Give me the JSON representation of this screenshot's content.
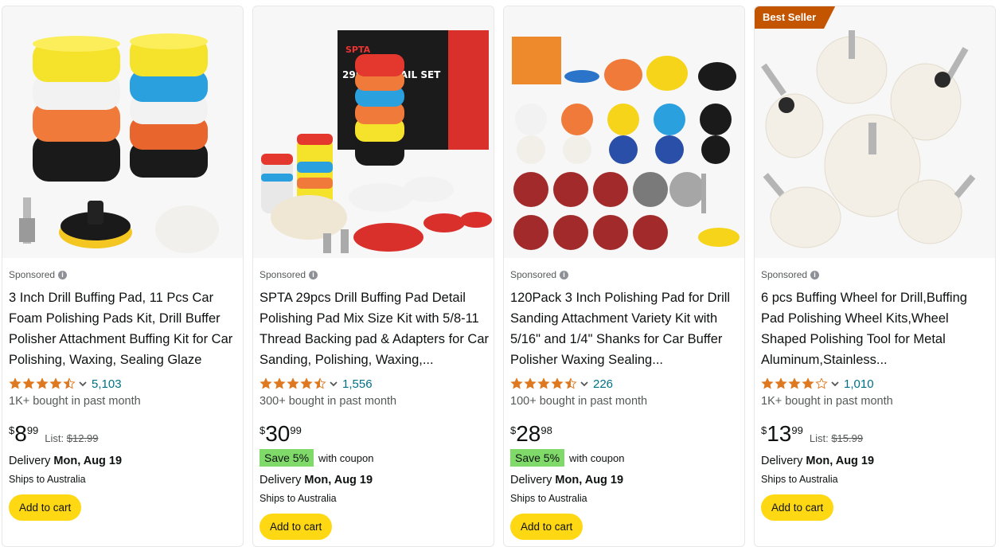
{
  "products": [
    {
      "sponsored": "Sponsored",
      "title": "3 Inch Drill Buffing Pad, 11 Pcs Car Foam Polishing Pads Kit, Drill Buffer Polisher Attachment Buffing Kit for Car Polishing, Waxing, Sealing Glaze",
      "rating": 4.5,
      "reviews": "5,103",
      "bought": "1K+ bought in past month",
      "price_currency": "$",
      "price_whole": "8",
      "price_fraction": "99",
      "list_label": "List:",
      "list_price": "$12.99",
      "delivery_label": "Delivery",
      "delivery_date": "Mon, Aug 19",
      "ships": "Ships to Australia",
      "cta": "Add to cart"
    },
    {
      "sponsored": "Sponsored",
      "title": "SPTA 29pcs Drill Buffing Pad Detail Polishing Pad Mix Size Kit with 5/8-11 Thread Backing pad & Adapters for Car Sanding, Polishing, Waxing,...",
      "rating": 4.5,
      "reviews": "1,556",
      "bought": "300+ bought in past month",
      "price_currency": "$",
      "price_whole": "30",
      "price_fraction": "99",
      "coupon_badge": "Save 5%",
      "coupon_text": "with coupon",
      "delivery_label": "Delivery",
      "delivery_date": "Mon, Aug 19",
      "ships": "Ships to Australia",
      "cta": "Add to cart",
      "image_brand_text": "SPTA",
      "image_box_text": "29PCS DETAIL SET"
    },
    {
      "sponsored": "Sponsored",
      "title": "120Pack 3 Inch Polishing Pad for Drill Sanding Attachment Variety Kit with 5/16\" and 1/4\" Shanks for Car Buffer Polisher Waxing Sealing...",
      "rating": 4.5,
      "reviews": "226",
      "bought": "100+ bought in past month",
      "price_currency": "$",
      "price_whole": "28",
      "price_fraction": "98",
      "coupon_badge": "Save 5%",
      "coupon_text": "with coupon",
      "delivery_label": "Delivery",
      "delivery_date": "Mon, Aug 19",
      "ships": "Ships to Australia",
      "cta": "Add to cart"
    },
    {
      "badge": "Best Seller",
      "sponsored": "Sponsored",
      "title": "6 pcs Buffing Wheel for Drill,Buffing Pad Polishing Wheel Kits,Wheel Shaped Polishing Tool for Metal Aluminum,Stainless...",
      "rating": 4.0,
      "reviews": "1,010",
      "bought": "1K+ bought in past month",
      "price_currency": "$",
      "price_whole": "13",
      "price_fraction": "99",
      "list_label": "List:",
      "list_price": "$15.99",
      "delivery_label": "Delivery",
      "delivery_date": "Mon, Aug 19",
      "ships": "Ships to Australia",
      "cta": "Add to cart"
    }
  ],
  "colors": {
    "star": "#de7921",
    "link": "#007185",
    "cta": "#ffd814",
    "coupon": "#7fda69",
    "badge": "#c45500"
  },
  "icons": {
    "info": "info-circle-icon",
    "chevron": "chevron-down-icon",
    "star": "star-icon"
  }
}
